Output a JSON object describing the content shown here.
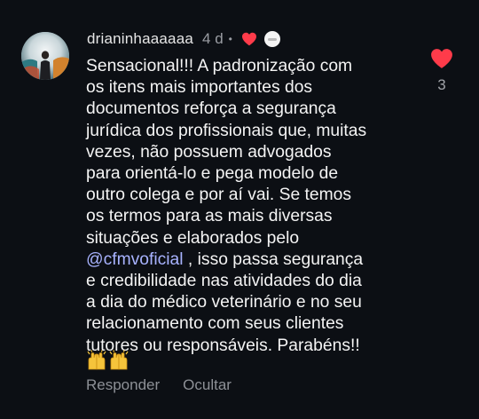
{
  "comment": {
    "username": "drianinhaaaaaa",
    "time": "4 d",
    "separator": "•",
    "text_before": "Sensacional!!! A padronização com\nos itens mais importantes dos\ndocumentos reforça a segurança\njurídica dos profissionais que, muitas\nvezes, não possuem advogados\npara orientá-lo e pega modelo de\noutro colega e por aí vai. Se temos\nos termos para as mais diversas\nsituações e elaborados pelo\n",
    "mention": "@cfmvoficial",
    "text_after": " , isso passa segurança\ne credibilidade nas atividades do dia\na dia do médico veterinário e no seu\nrelacionamento com seus clientes\ntutores ou responsáveis. Parabéns!!",
    "emoji": [
      "raising-hands",
      "raising-hands"
    ],
    "reply_label": "Responder",
    "hide_label": "Ocultar",
    "like_count": "3"
  },
  "colors": {
    "background": "#0c0f14",
    "text": "#f4f4f4",
    "muted": "#8d9096",
    "mention": "#a8b3ff",
    "heart": "#ff3b4a"
  }
}
